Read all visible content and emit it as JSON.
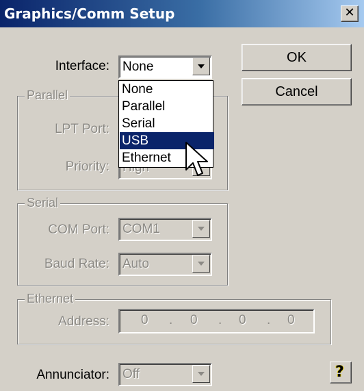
{
  "window": {
    "title": "Graphics/Comm Setup",
    "close_glyph": "✕"
  },
  "buttons": {
    "ok": "OK",
    "cancel": "Cancel",
    "help_glyph": "?"
  },
  "interface": {
    "label": "Interface:",
    "value": "None",
    "options": [
      "None",
      "Parallel",
      "Serial",
      "USB",
      "Ethernet"
    ],
    "highlighted": "USB"
  },
  "parallel": {
    "title": "Parallel",
    "lpt_label": "LPT Port:",
    "priority_label": "Priority:",
    "priority_value": "High"
  },
  "serial": {
    "title": "Serial",
    "com_label": "COM Port:",
    "com_value": "COM1",
    "baud_label": "Baud Rate:",
    "baud_value": "Auto"
  },
  "ethernet": {
    "title": "Ethernet",
    "address_label": "Address:",
    "octets": [
      "0",
      "0",
      "0",
      "0"
    ],
    "dot": "."
  },
  "annunciator": {
    "label": "Annunciator:",
    "value": "Off"
  },
  "icons": {
    "close": "close-icon",
    "help": "help-icon",
    "cursor": "mouse-pointer-icon",
    "dropdown": "chevron-down-icon"
  },
  "colors": {
    "title_active": "#0a246a",
    "face": "#d4d0c8",
    "selection": "#0a246a",
    "disabled_text": "#8c8a85"
  }
}
